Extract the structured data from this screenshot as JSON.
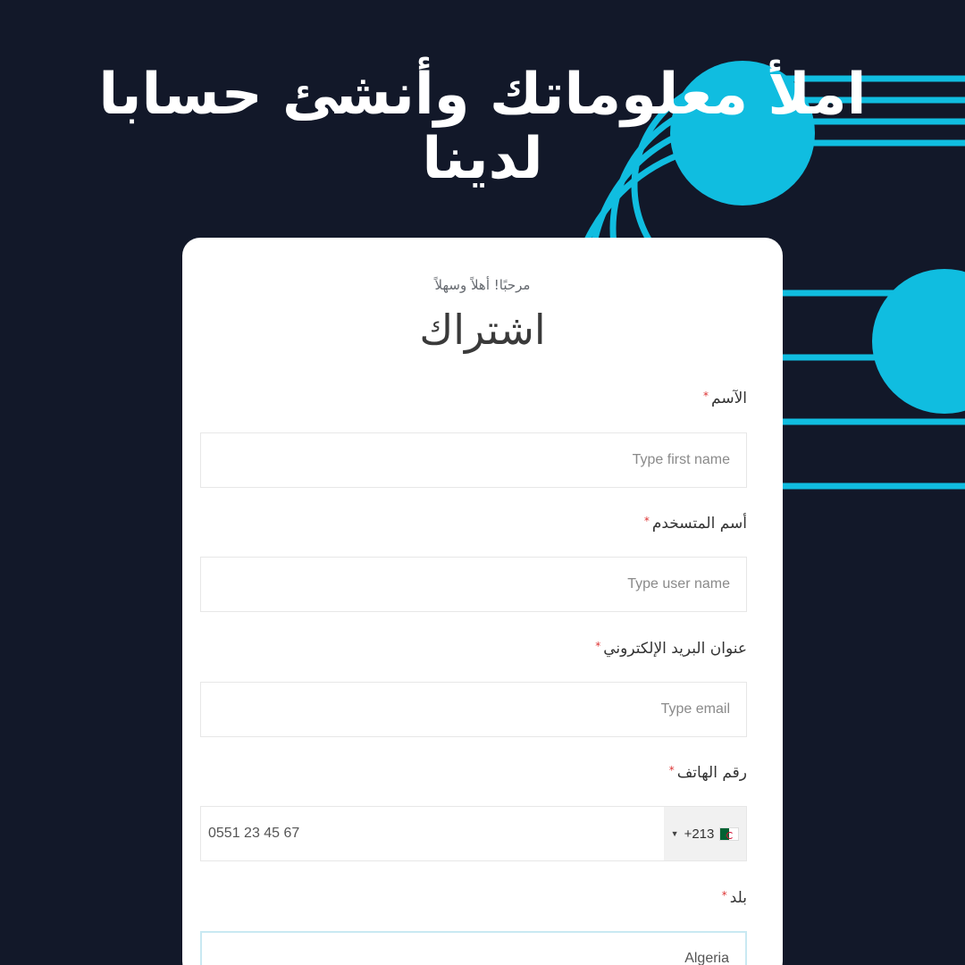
{
  "headline": {
    "line1": "املأ معلوماتك وأنشئ حسابا",
    "line2": "لدينا"
  },
  "form": {
    "welcome": "مرحبًا! أهلاً وسهلاً",
    "title": "اشتراك",
    "required_mark": "*",
    "fields": {
      "name": {
        "label": "الآسم",
        "placeholder": "Type first name"
      },
      "username": {
        "label": "أسم المتسخدم",
        "placeholder": "Type user name"
      },
      "email": {
        "label": "عنوان البريد الإلكتروني",
        "placeholder": "Type email"
      },
      "phone": {
        "label": "رقم الهاتف",
        "country_code": "+213",
        "value": "0551 23 45 67",
        "flag": "algeria-flag-icon"
      },
      "country": {
        "label": "بلد",
        "value": "Algeria"
      }
    }
  },
  "colors": {
    "background": "#121829",
    "accent": "#10bde0",
    "card": "#ffffff"
  }
}
